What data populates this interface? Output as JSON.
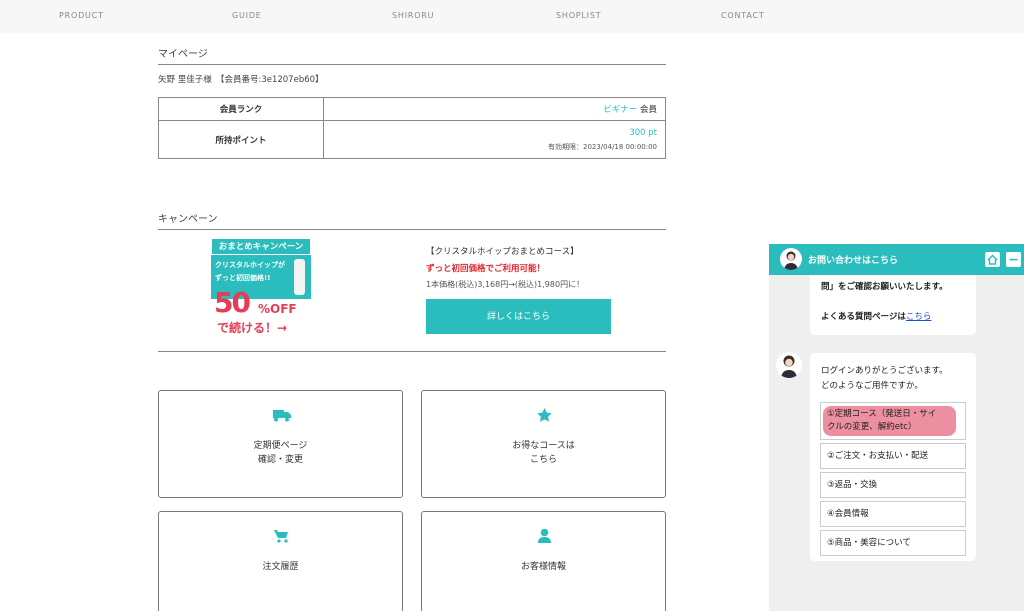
{
  "nav": [
    "PRODUCT",
    "GUIDE",
    "SHIRORU",
    "SHOPLIST",
    "CONTACT"
  ],
  "mypage": {
    "title": "マイページ",
    "member_line": "矢野 里佳子様　【会員番号:3e1207eb60】",
    "rank_label": "会員ランク",
    "rank_value": "ビギナー",
    "rank_suffix": " 会員",
    "points_label": "所持ポイント",
    "points_value": "300",
    "points_unit": " pt",
    "expiry": "有効期限：2023/04/18 00:00:00"
  },
  "campaign": {
    "title": "キャンペーン",
    "banner_head": "おまとめキャンペーン",
    "banner_line1": "クリスタルホイップが",
    "banner_line2": "ずっと初回価格!!",
    "banner_pct": "50",
    "banner_off": "%OFF",
    "banner_cont": "で続ける！→",
    "course_title": "【クリスタルホイップおまとめコース】",
    "course_sub": "ずっと初回価格でご利用可能！",
    "course_price": "1本価格(税込)3,168円→(税込)1,980円に！",
    "detail_button": "詳しくはこちら"
  },
  "cards": [
    {
      "line1": "定期便ページ",
      "line2": "確認・変更",
      "icon": "truck-icon"
    },
    {
      "line1": "お得なコースは",
      "line2": "こちら",
      "icon": "star-icon"
    },
    {
      "line1": "注文履歴",
      "line2": "",
      "icon": "cart-icon"
    },
    {
      "line1": "お客様情報",
      "line2": "",
      "icon": "user-icon"
    }
  ],
  "chat": {
    "header_title": "お問い合わせはこちら",
    "prev_msg_line1": "問」をご確認お願いいたします。",
    "faq_prefix": "よくある質問ページは",
    "faq_link": "こちら",
    "greeting_line1": "ログインありがとうございます。",
    "greeting_line2": "どのようなご用件ですか。",
    "options": [
      "①定期コース（発送日・サイ",
      "クルの変更、解約etc）",
      "②ご注文・お支払い・配送",
      "③返品・交換",
      "④会員情報",
      "⑤商品・美容について"
    ]
  },
  "colors": {
    "accent": "#2bbdbd",
    "alert": "#e0252d",
    "highlight": "#ec8fa0"
  }
}
